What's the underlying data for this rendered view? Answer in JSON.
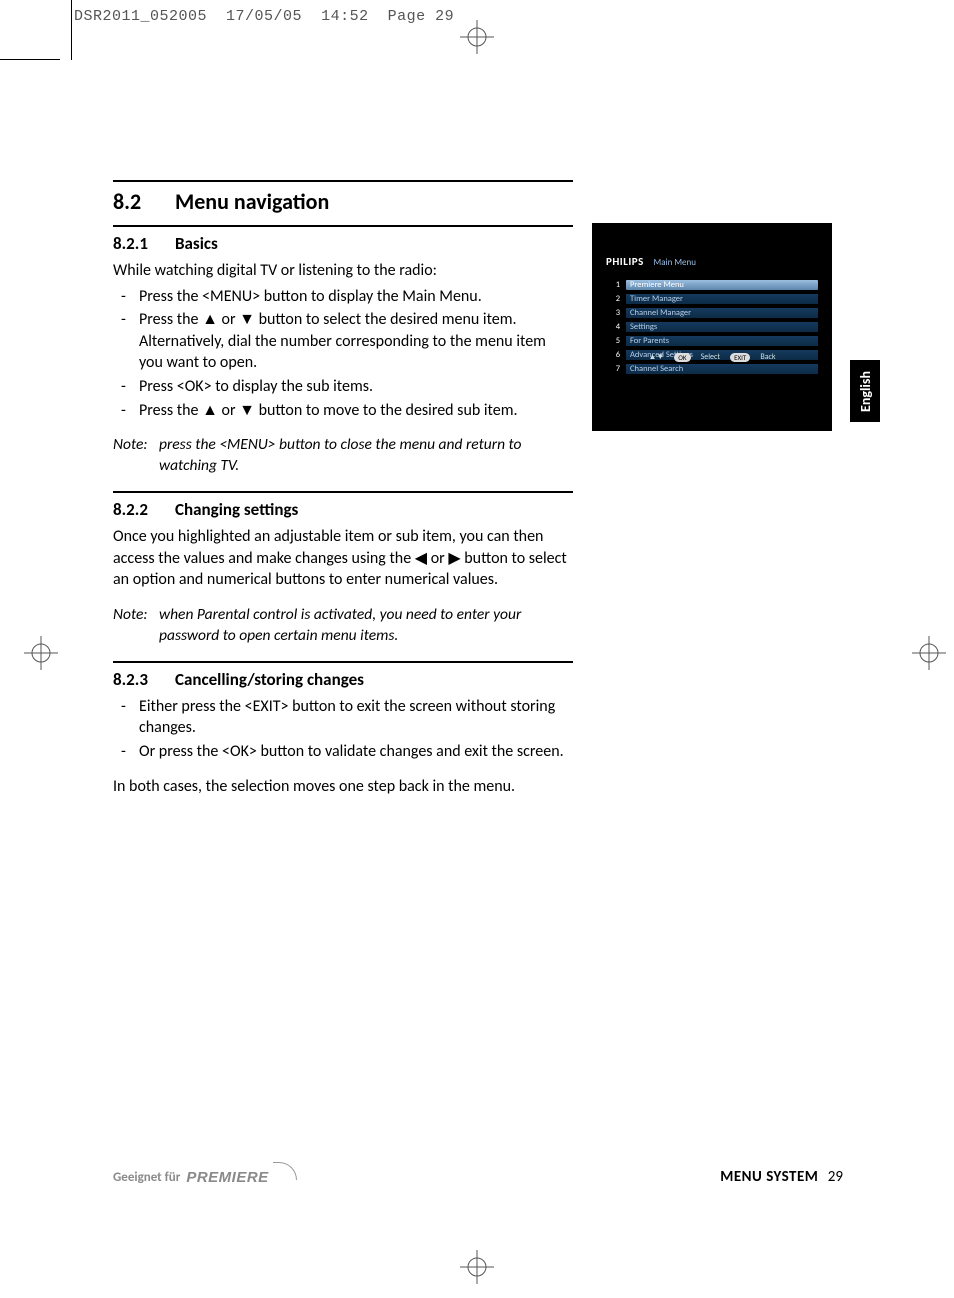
{
  "prepress": {
    "filename": "DSR2011_052005",
    "date": "17/05/05",
    "time": "14:52",
    "page_label": "Page 29"
  },
  "heading": {
    "number": "8.2",
    "title": "Menu navigation"
  },
  "sections": [
    {
      "number": "8.2.1",
      "title": "Basics",
      "intro": "While watching digital TV or listening to the radio:",
      "bullets": [
        "Press the <MENU> button to display the Main Menu.",
        "Press the ▲ or ▼ button to select the desired menu item. Alternatively, dial the number corresponding to the menu item you want to open.",
        "Press <OK> to display the sub items.",
        "Press the ▲ or ▼ button to move to the desired sub item."
      ],
      "note_label": "Note:",
      "note": "press the <MENU> button to close the menu and return to watching TV."
    },
    {
      "number": "8.2.2",
      "title": "Changing settings",
      "intro": "Once you highlighted an adjustable item or sub item, you can then access the values and make changes using the ◀ or ▶ button to select an option and numerical buttons to enter numerical values.",
      "note_label": "Note:",
      "note": "when Parental control is activated, you need to enter your password to open certain menu items."
    },
    {
      "number": "8.2.3",
      "title": "Cancelling/storing changes",
      "bullets": [
        "Either press the <EXIT> button to exit the screen without storing changes.",
        "Or press the <OK> button to validate changes and exit the screen."
      ],
      "closing": "In both cases, the selection moves one step back in the menu."
    }
  ],
  "tv_screenshot": {
    "brand": "PHILIPS",
    "screen_title": "Main Menu",
    "items": [
      {
        "idx": "1",
        "label": "Premiere Menu",
        "highlight": true
      },
      {
        "idx": "2",
        "label": "Timer Manager",
        "highlight": false
      },
      {
        "idx": "3",
        "label": "Channel Manager",
        "highlight": false
      },
      {
        "idx": "4",
        "label": "Settings",
        "highlight": false
      },
      {
        "idx": "5",
        "label": "For Parents",
        "highlight": false
      },
      {
        "idx": "6",
        "label": "Advanced Settings",
        "highlight": false
      },
      {
        "idx": "7",
        "label": "Channel Search",
        "highlight": false
      }
    ],
    "footer": {
      "nav_icon": "▲▼",
      "ok_pill": "OK",
      "ok_label": "Select",
      "exit_pill": "EXIT",
      "exit_label": "Back"
    }
  },
  "language_tab": "English",
  "footer": {
    "left_prefix": "Geeignet für",
    "premiere_logo": "PREMIERE",
    "section": "MENU SYSTEM",
    "page": "29"
  }
}
